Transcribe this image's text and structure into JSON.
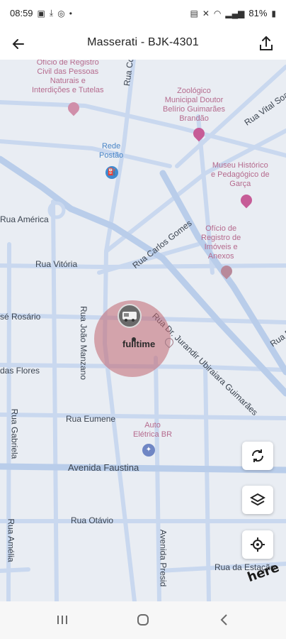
{
  "status_bar": {
    "time": "08:59",
    "battery": "81%"
  },
  "app_bar": {
    "title": "Masserati - BJK-4301"
  },
  "map": {
    "streets": [
      "Rua Coronel",
      "Rua Vital Soa",
      "Rua América",
      "Rua Vitória",
      "sé Rosário",
      "Rua João Manzano",
      "das Flores",
      "Rua Carlos Gomes",
      "Rua Dr. Jurandir Ubiraiara Guimarães",
      "Rua P",
      "Rua Eumene",
      "Avenida Faustina",
      "Rua Gabriela",
      "Rua Otávio",
      "Rua Amélia",
      "Avenida Presid",
      "Rua da Estação"
    ],
    "pois": {
      "top_left": "Ofício de Registro\nCivil das Pessoas\nNaturais e\nInterdições e Tutelas",
      "zoo": "Zoológico\nMunicipal Doutor\nBelírio Guimarães\nBrandão",
      "gas_station": "Rede\nPostão",
      "museum": "Museu Histórico\ne Pedagógico de\nGarça",
      "registry": "Ofício de\nRegistro de\nImóveis e\nAnexos",
      "auto_shop": "Auto\nElétrica BR"
    },
    "vehicle": {
      "label": "fulltime",
      "icon": "truck-icon"
    },
    "geofence_color": "#c1666f",
    "attribution": "here"
  },
  "colors": {
    "map_bg": "#e9edf3",
    "road": "#c7d6ee",
    "road_major": "#aec6e8"
  }
}
